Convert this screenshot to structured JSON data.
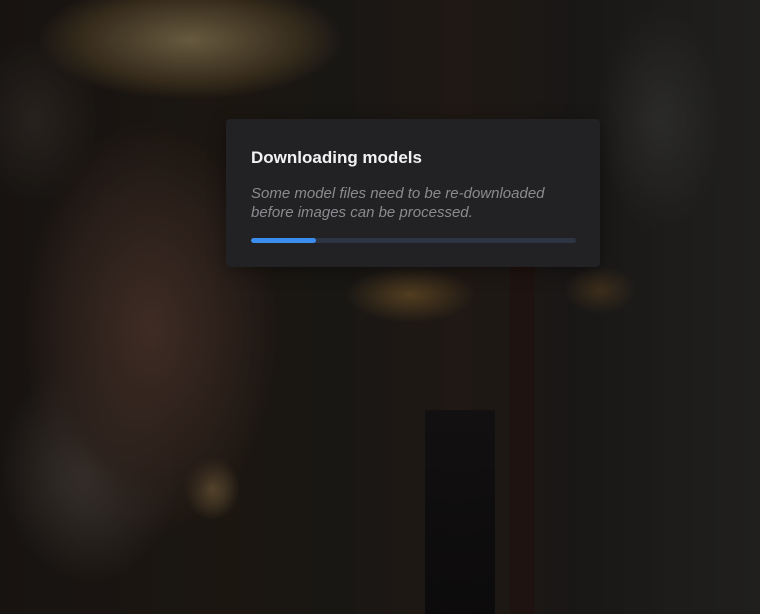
{
  "dialog": {
    "title": "Downloading models",
    "description_line1": "Some model files need to be re-downloaded",
    "description_line2": "before images can be processed."
  },
  "progress": {
    "fraction": 0.2,
    "fill_color": "#3b8eed",
    "track_color": "#2d3545"
  }
}
